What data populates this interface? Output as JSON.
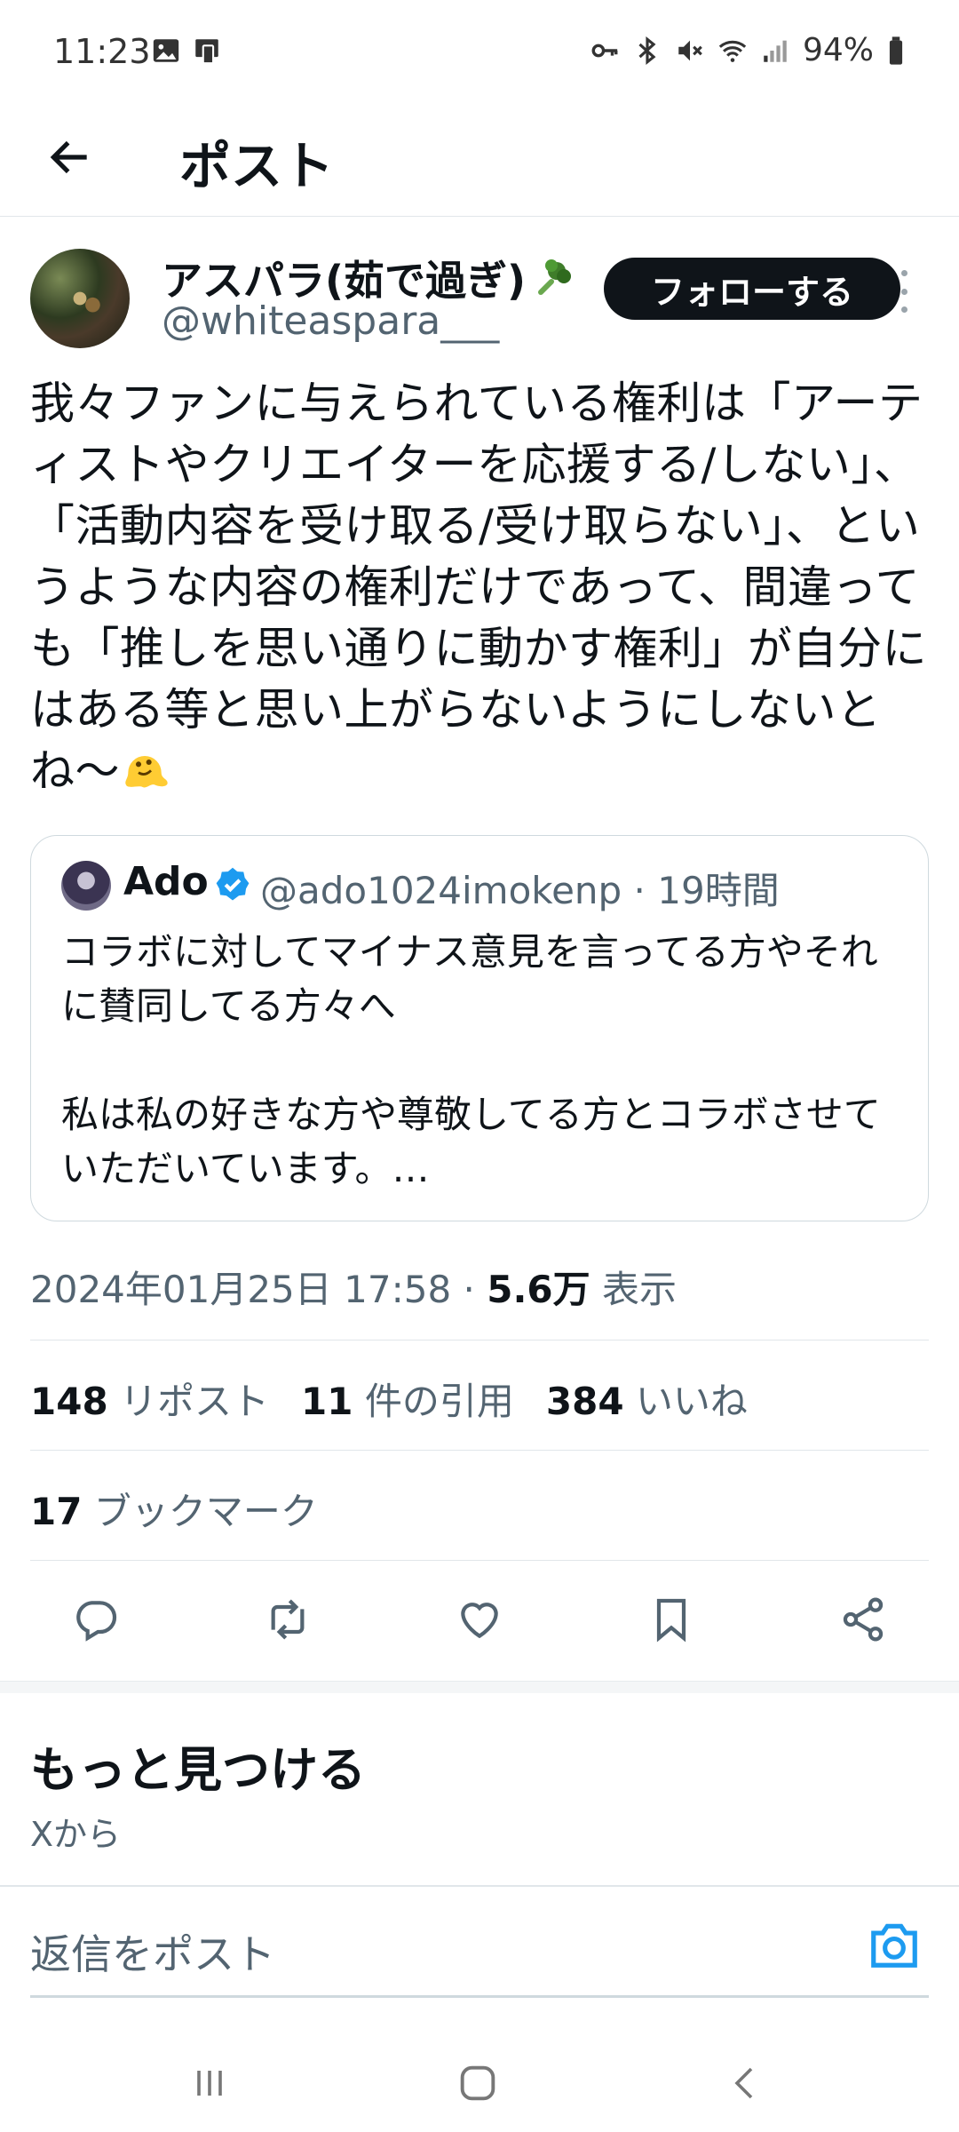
{
  "status_bar": {
    "time": "11:23",
    "battery": "94%",
    "left_icons": [
      "gallery-icon",
      "screen-cast-icon"
    ],
    "right_icons": [
      "key-icon",
      "bluetooth-icon",
      "mute-icon",
      "wifi-icon",
      "signal-icon",
      "battery-icon"
    ]
  },
  "header": {
    "title": "ポスト"
  },
  "post": {
    "user_name": "アスパラ(茹で過ぎ)",
    "handle": "@whiteaspara___",
    "follow_label": "フォローする",
    "text": "我々ファンに与えられている権利は「アーティストやクリエイターを応援する/しない」、「活動内容を受け取る/受け取らない」、というような内容の権利だけであって、間違っても「推しを思い通りに動かす権利」が自分にはある等と思い上がらないようにしないとね〜",
    "quote": {
      "name": "Ado",
      "handle_time": "@ado1024imokenp · 19時間",
      "text": "コラボに対してマイナス意見を言ってる方やそれに賛同してる方々へ\n\n私は私の好きな方や尊敬してる方とコラボさせていただいています。…"
    },
    "timestamp": "2024年01月25日 17:58 · ",
    "views_count": "5.6万",
    "views_label": " 表示"
  },
  "stats": {
    "reposts_count": "148",
    "reposts_label": "リポスト",
    "quotes_count": "11",
    "quotes_label": "件の引用",
    "likes_count": "384",
    "likes_label": "いいね",
    "bookmarks_count": "17",
    "bookmarks_label": "ブックマーク"
  },
  "discover": {
    "title": "もっと見つける",
    "subtitle": "Xから"
  },
  "reply": {
    "placeholder": "返信をポスト"
  },
  "colors": {
    "accent": "#1d9bf0",
    "text": "#0f1419",
    "secondary": "#536471",
    "border": "#cfd9de"
  }
}
